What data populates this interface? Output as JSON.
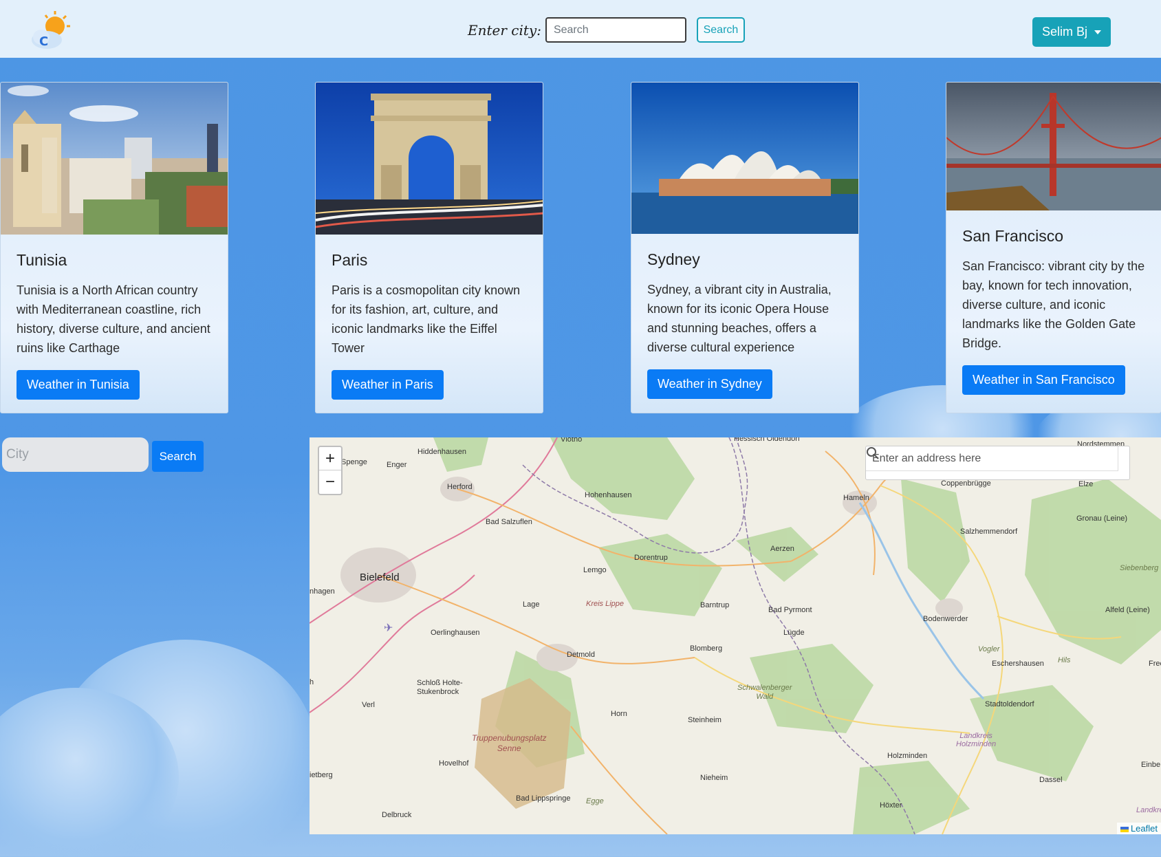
{
  "navbar": {
    "label": "Enter city:",
    "search_placeholder": "Search",
    "search_button": "Search",
    "user_menu": "Selim Bj"
  },
  "cards": [
    {
      "title": "Tunisia",
      "text": "Tunisia is a North African country with Mediterranean coastline, rich history, diverse culture, and ancient ruins like Carthage",
      "button": "Weather in Tunisia"
    },
    {
      "title": "Paris",
      "text": "Paris is a cosmopolitan city known for its fashion, art, culture, and iconic landmarks like the Eiffel Tower",
      "button": "Weather in Paris"
    },
    {
      "title": "Sydney",
      "text": "Sydney, a vibrant city in Australia, known for its iconic Opera House and stunning beaches, offers a diverse cultural experience",
      "button": "Weather in Sydney"
    },
    {
      "title": "San Francisco",
      "text": "San Francisco: vibrant city by the bay, known for tech innovation, diverse culture, and iconic landmarks like the Golden Gate Bridge.",
      "button": "Weather in San Francisco"
    }
  ],
  "city_search": {
    "placeholder": "City",
    "button": "Search"
  },
  "map": {
    "zoom_in": "+",
    "zoom_out": "−",
    "address_placeholder": "Enter an address here",
    "attribution": "Leaflet",
    "places": {
      "hiddenhausen": "Hiddenhausen",
      "enger": "Enger",
      "spenge": "Spenge",
      "herford": "Herford",
      "vlotho": "Vlotho",
      "hohenhausen": "Hohenhausen",
      "bad_salzuflen": "Bad Salzuflen",
      "bielefeld": "Bielefeld",
      "dorentrup": "Dorentrup",
      "lemgo": "Lemgo",
      "lage": "Lage",
      "kreis_lippe": "Kreis Lippe",
      "barntrup": "Barntrup",
      "oerlinghausen": "Oerlinghausen",
      "detmold": "Detmold",
      "blomberg": "Blomberg",
      "schloss": "Schloß Holte-\nStukenbrock",
      "verl": "Verl",
      "horn": "Horn",
      "steinheim": "Steinheim",
      "truppen": "Truppenubungsplatz\nSenne",
      "hovelhof": "Hovelhof",
      "rietberg": "ietberg",
      "nieheim": "Nieheim",
      "bad_lippspringe": "Bad Lippspringe",
      "egge": "Egge",
      "delbruck": "Delbruck",
      "hameln": "Hameln",
      "coppenbrugge": "Coppenbrügge",
      "elze": "Elze",
      "gronau": "Gronau (Leine)",
      "salzhemmendorf": "Salzhemmendorf",
      "aerzen": "Aerzen",
      "siebenberg": "Siebenberg",
      "bad_pyrmont": "Bad Pyrmont",
      "lugde": "Lügde",
      "bodenwerder": "Bodenwerder",
      "alfeld": "Alfeld (Leine)",
      "vogler": "Vogler",
      "eschershausen": "Eschershausen",
      "hils": "Hils",
      "schwalenberger": "Schwalenberger\nWald",
      "stadtoldendorf": "Stadtoldendorf",
      "landkreis": "Landkreis\nHolzminden",
      "holzminden": "Holzminden",
      "einbeck": "Einbe",
      "dassel": "Dassel",
      "hoxter": "Höxter",
      "nordstemmen": "Nordstemmen",
      "hessisch": "Hessisch Oldendorf",
      "hagen": "nhagen",
      "gh": "h",
      "frec": "Frec",
      "landkr2": "Landkre"
    }
  }
}
